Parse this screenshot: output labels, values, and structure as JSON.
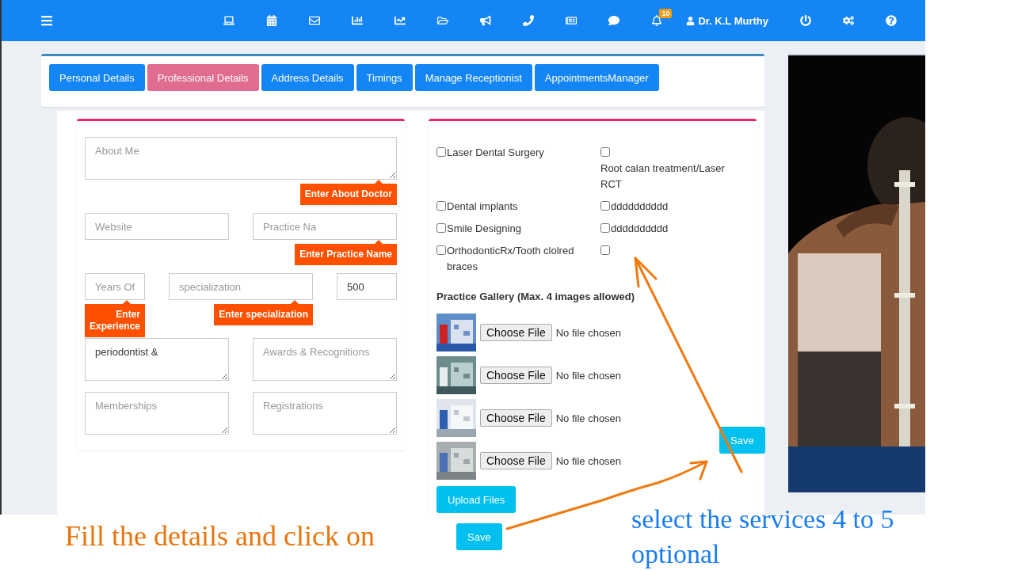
{
  "topbar": {
    "notification_count": "10",
    "user": "Dr. K.L Murthy"
  },
  "tabs": [
    {
      "label": "Personal Details",
      "selected": false
    },
    {
      "label": "Professional Details",
      "selected": true
    },
    {
      "label": "Address Details",
      "selected": false
    },
    {
      "label": "Timings",
      "selected": false
    },
    {
      "label": "Manage Receptionist",
      "selected": false
    },
    {
      "label": "AppointmentsManager",
      "selected": false
    }
  ],
  "profile_form": {
    "about_me": {
      "placeholder": "About Me",
      "tooltip": "Enter About Doctor"
    },
    "website": {
      "placeholder": "Website"
    },
    "practice_name": {
      "placeholder": "Practice Na",
      "tooltip": "Enter Practice Name"
    },
    "experience": {
      "placeholder": "Years Of",
      "tooltip": "Enter Experience"
    },
    "specialization": {
      "placeholder": "specialization",
      "tooltip": "Enter specialization"
    },
    "fee": {
      "value": "500"
    },
    "qualification": {
      "value": "periodontist &"
    },
    "awards": {
      "placeholder": "Awards & Recognitions"
    },
    "memberships": {
      "placeholder": "Memberships"
    },
    "registrations": {
      "placeholder": "Registrations"
    }
  },
  "services": [
    {
      "label": "Laser Dental Surgery",
      "checked": false
    },
    {
      "label": "Root calan treatment/Laser RCT",
      "checked": false
    },
    {
      "label": "Dental implants",
      "checked": false
    },
    {
      "label": "dddddddddd",
      "checked": false
    },
    {
      "label": "Smile Designing",
      "checked": false
    },
    {
      "label": "dddddddddd",
      "checked": false
    },
    {
      "label": "OrthodonticRx/Tooth clolred braces",
      "checked": false
    },
    {
      "checked": false
    }
  ],
  "gallery": {
    "title": "Practice Gallery (Max. 4 images allowed)",
    "items": [
      {
        "button": "Choose File",
        "status": "No file chosen"
      },
      {
        "button": "Choose File",
        "status": "No file chosen"
      },
      {
        "button": "Choose File",
        "status": "No file chosen"
      },
      {
        "button": "Choose File",
        "status": "No file chosen"
      }
    ],
    "upload_button": "Upload Files"
  },
  "save_button": "Save",
  "annotations": {
    "left_text": "Fill the details and click on",
    "save_button": "Save",
    "right_text": "select the services 4 to 5 optional"
  }
}
